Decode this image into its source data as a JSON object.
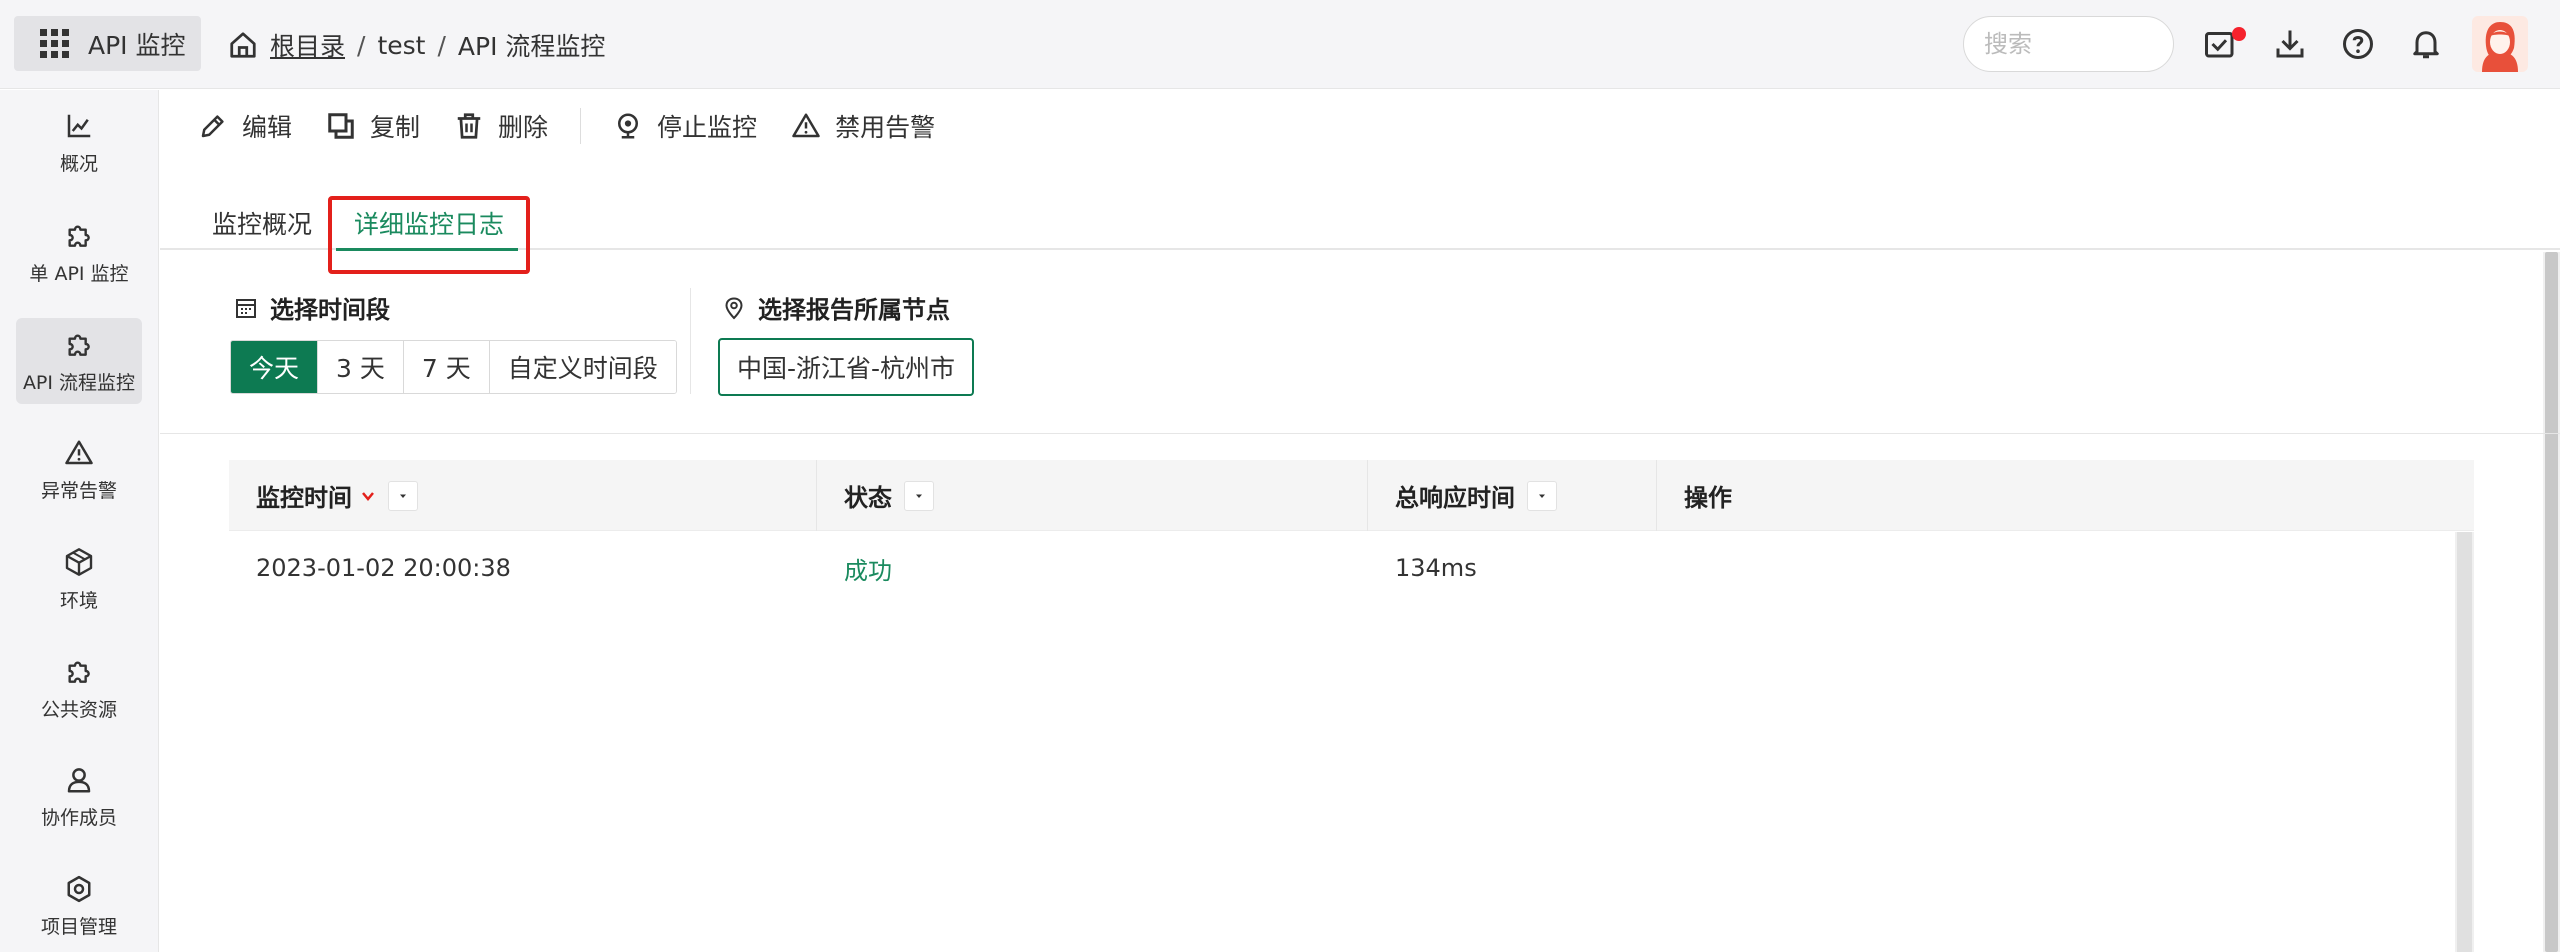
{
  "app": {
    "title": "API 监控"
  },
  "breadcrumb": {
    "root": "根目录",
    "items": [
      "test",
      "API 流程监控"
    ],
    "separator": "/"
  },
  "search": {
    "placeholder": "搜索",
    "value": ""
  },
  "header_icons": [
    "task-icon",
    "download-icon",
    "help-icon",
    "bell-icon"
  ],
  "sidebar": {
    "items": [
      {
        "label": "概况",
        "icon": "chart-icon"
      },
      {
        "label": "单 API 监控",
        "icon": "puzzle-icon"
      },
      {
        "label": "API 流程监控",
        "icon": "puzzle-icon",
        "active": true
      },
      {
        "label": "异常告警",
        "icon": "warning-icon"
      },
      {
        "label": "环境",
        "icon": "cube-icon"
      },
      {
        "label": "公共资源",
        "icon": "puzzle-icon"
      },
      {
        "label": "协作成员",
        "icon": "users-icon"
      },
      {
        "label": "项目管理",
        "icon": "gear-icon"
      }
    ]
  },
  "toolbar": {
    "edit": "编辑",
    "copy": "复制",
    "delete": "删除",
    "stop_monitor": "停止监控",
    "disable_alert": "禁用告警"
  },
  "tabs": [
    {
      "label": "监控概况",
      "active": false
    },
    {
      "label": "详细监控日志",
      "active": true
    }
  ],
  "filters": {
    "time_title": "选择时间段",
    "time_options": [
      {
        "label": "今天",
        "active": true
      },
      {
        "label": "3 天",
        "active": false
      },
      {
        "label": "7 天",
        "active": false
      },
      {
        "label": "自定义时间段",
        "active": false
      }
    ],
    "node_title": "选择报告所属节点",
    "node_value": "中国-浙江省-杭州市"
  },
  "table": {
    "columns": [
      "监控时间",
      "状态",
      "总响应时间",
      "操作"
    ],
    "rows": [
      {
        "time": "2023-01-02 20:00:38",
        "status": "成功",
        "response": "134ms",
        "actions": ""
      }
    ]
  },
  "colors": {
    "accent": "#0d7a52",
    "success": "#1a8a5e",
    "highlight": "#e3201b",
    "notification_dot": "#f5222d"
  }
}
